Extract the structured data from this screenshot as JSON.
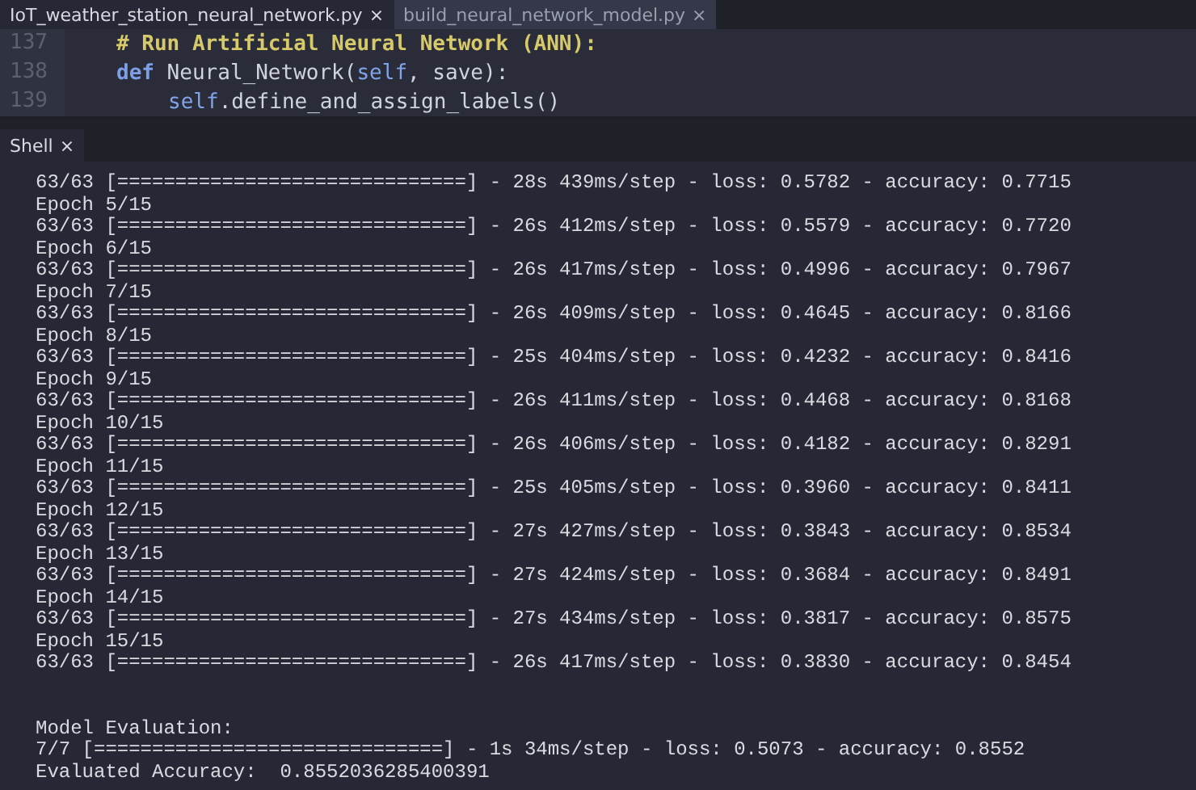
{
  "editor_tabs": [
    {
      "label": "IoT_weather_station_neural_network.py",
      "close": "×",
      "selected": true
    },
    {
      "label": "build_neural_network_model.py",
      "close": "×",
      "selected": false
    }
  ],
  "editor": {
    "lines": [
      {
        "number": "137",
        "segments": [
          {
            "kind": "comment",
            "text": "# Run Artificial Neural Network (ANN):"
          }
        ]
      },
      {
        "number": "138",
        "segments": [
          {
            "kind": "keyword",
            "text": "def"
          },
          {
            "kind": "plain",
            "text": " Neural_Network("
          },
          {
            "kind": "self",
            "text": "self"
          },
          {
            "kind": "plain",
            "text": ", save):"
          }
        ],
        "children": [
          {
            "number": "139",
            "segments": [
              {
                "kind": "self",
                "text": "self"
              },
              {
                "kind": "plain",
                "text": ".define_and_assign_labels()"
              }
            ]
          }
        ]
      }
    ]
  },
  "shell_tab": {
    "label": "Shell",
    "close": "×",
    "selected": true
  },
  "shell": {
    "training_lines": [
      "63/63 [==============================] - 28s 439ms/step - loss: 0.5782 - accuracy: 0.7715",
      "Epoch 5/15",
      "63/63 [==============================] - 26s 412ms/step - loss: 0.5579 - accuracy: 0.7720",
      "Epoch 6/15",
      "63/63 [==============================] - 26s 417ms/step - loss: 0.4996 - accuracy: 0.7967",
      "Epoch 7/15",
      "63/63 [==============================] - 26s 409ms/step - loss: 0.4645 - accuracy: 0.8166",
      "Epoch 8/15",
      "63/63 [==============================] - 25s 404ms/step - loss: 0.4232 - accuracy: 0.8416",
      "Epoch 9/15",
      "63/63 [==============================] - 26s 411ms/step - loss: 0.4468 - accuracy: 0.8168",
      "Epoch 10/15",
      "63/63 [==============================] - 26s 406ms/step - loss: 0.4182 - accuracy: 0.8291",
      "Epoch 11/15",
      "63/63 [==============================] - 25s 405ms/step - loss: 0.3960 - accuracy: 0.8411",
      "Epoch 12/15",
      "63/63 [==============================] - 27s 427ms/step - loss: 0.3843 - accuracy: 0.8534",
      "Epoch 13/15",
      "63/63 [==============================] - 27s 424ms/step - loss: 0.3684 - accuracy: 0.8491",
      "Epoch 14/15",
      "63/63 [==============================] - 27s 434ms/step - loss: 0.3817 - accuracy: 0.8575",
      "Epoch 15/15",
      "63/63 [==============================] - 26s 417ms/step - loss: 0.3830 - accuracy: 0.8454"
    ],
    "evaluation_lines": [
      "Model Evaluation:",
      "7/7 [==============================] - 1s 34ms/step - loss: 0.5073 - accuracy: 0.8552",
      "Evaluated Accuracy:  0.8552036285400391"
    ]
  }
}
